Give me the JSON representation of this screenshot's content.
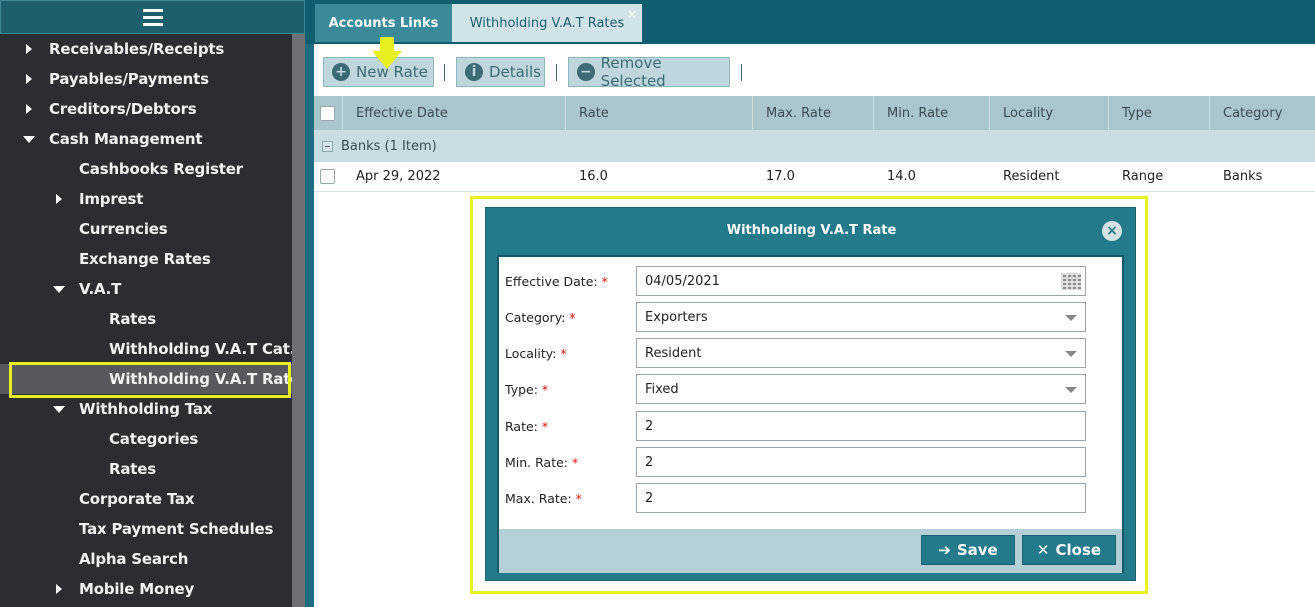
{
  "sidebar": {
    "items": [
      {
        "label": "Receivables/Receipts",
        "arrow": "right"
      },
      {
        "label": "Payables/Payments",
        "arrow": "right"
      },
      {
        "label": "Creditors/Debtors",
        "arrow": "right"
      },
      {
        "label": "Cash Management",
        "arrow": "down"
      },
      {
        "label": "Cashbooks Register",
        "arrow": "none"
      },
      {
        "label": "Imprest",
        "arrow": "right"
      },
      {
        "label": "Currencies",
        "arrow": "none"
      },
      {
        "label": "Exchange Rates",
        "arrow": "none"
      },
      {
        "label": "V.A.T",
        "arrow": "down"
      },
      {
        "label": "Rates",
        "arrow": "none"
      },
      {
        "label": "Withholding V.A.T Cat...",
        "arrow": "none"
      },
      {
        "label": "Withholding V.A.T Rates",
        "arrow": "none",
        "selected": true
      },
      {
        "label": "Withholding Tax",
        "arrow": "down"
      },
      {
        "label": "Categories",
        "arrow": "none"
      },
      {
        "label": "Rates",
        "arrow": "none"
      },
      {
        "label": "Corporate Tax",
        "arrow": "none"
      },
      {
        "label": "Tax Payment Schedules",
        "arrow": "none"
      },
      {
        "label": "Alpha Search",
        "arrow": "none"
      },
      {
        "label": "Mobile Money",
        "arrow": "right"
      }
    ]
  },
  "tabs": [
    {
      "label": "Accounts Links"
    },
    {
      "label": "Withholding V.A.T Rates",
      "close": "×"
    }
  ],
  "toolbar": {
    "new_rate": "New Rate",
    "details": "Details",
    "remove_selected": "Remove Selected"
  },
  "grid": {
    "columns": [
      "Effective Date",
      "Rate",
      "Max. Rate",
      "Min. Rate",
      "Locality",
      "Type",
      "Category"
    ],
    "group": "Banks (1 Item)",
    "rows": [
      [
        "Apr 29, 2022",
        "16.0",
        "17.0",
        "14.0",
        "Resident",
        "Range",
        "Banks"
      ]
    ]
  },
  "modal": {
    "title": "Withholding V.A.T Rate",
    "close_x": "×",
    "fields": [
      {
        "label": "Effective Date:",
        "value": "04/05/2021",
        "kind": "date"
      },
      {
        "label": "Category:",
        "value": "Exporters",
        "kind": "select"
      },
      {
        "label": "Locality:",
        "value": "Resident",
        "kind": "select"
      },
      {
        "label": "Type:",
        "value": "Fixed",
        "kind": "select"
      },
      {
        "label": "Rate:",
        "value": "2",
        "kind": "text"
      },
      {
        "label": "Min. Rate:",
        "value": "2",
        "kind": "text"
      },
      {
        "label": "Max. Rate:",
        "value": "2",
        "kind": "text"
      }
    ],
    "required_mark": "*",
    "save_label": "Save",
    "close_label": "Close"
  },
  "colors": {
    "accent": "#237a8b",
    "highlight": "#e9f020",
    "sidebar_bg": "#2b2d31"
  }
}
